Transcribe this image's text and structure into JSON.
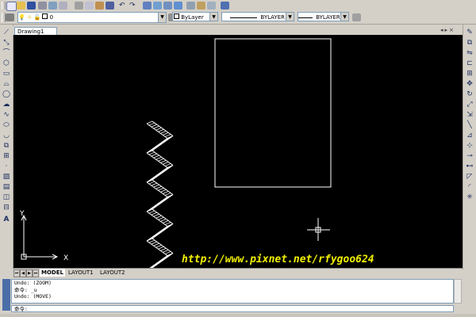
{
  "layer": {
    "name": "0"
  },
  "properties": {
    "color": "ByLayer",
    "linetype": "BYLAYER",
    "lineweight": "BYLAYER"
  },
  "document": {
    "tab_label": "Drawing1"
  },
  "layout_tabs": [
    "MODEL",
    "LAYOUT1",
    "LAYOUT2"
  ],
  "command_history": [
    "Undo: (ZOOM)",
    "命令: _u",
    "Undo: (MOVE)"
  ],
  "command_prompt": "命令:",
  "ucs": {
    "x_label": "X",
    "y_label": "Y"
  },
  "watermark": "http://www.pixnet.net/rfygoo624",
  "colors": {
    "canvas": "#000000",
    "watermark": "#f0f000",
    "toolbar": "#d4d0c8"
  }
}
